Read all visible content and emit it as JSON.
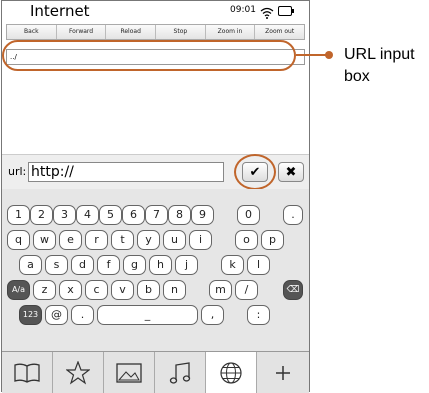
{
  "status": {
    "app_title": "Internet",
    "time": "09:01"
  },
  "toolbar": {
    "buttons": [
      "Back",
      "Forward",
      "Reload",
      "Stop",
      "Zoom in",
      "Zoom out"
    ]
  },
  "url_bar": {
    "value": "../"
  },
  "callout": {
    "label": "URL input box"
  },
  "url_entry": {
    "label": "url:",
    "value": "http://"
  },
  "keyboard": {
    "row1": [
      "1",
      "2",
      "3",
      "4",
      "5",
      "6",
      "7",
      "8",
      "9",
      "0",
      "."
    ],
    "row2": [
      "q",
      "w",
      "e",
      "r",
      "t",
      "y",
      "u",
      "i",
      "o",
      "p"
    ],
    "row3": [
      "a",
      "s",
      "d",
      "f",
      "g",
      "h",
      "j",
      "k",
      "l"
    ],
    "row4": [
      "A/a",
      "z",
      "x",
      "c",
      "v",
      "b",
      "n",
      "m",
      "/"
    ],
    "row5": [
      "123",
      "@",
      ".",
      "_",
      ",",
      ":"
    ]
  },
  "colors": {
    "highlight": "#c0652b"
  },
  "icons": [
    "book-icon",
    "star-icon",
    "image-icon",
    "music-icon",
    "globe-icon",
    "plus-icon",
    "wifi-icon",
    "battery-icon",
    "checkmark-icon",
    "close-icon",
    "backspace-icon"
  ]
}
